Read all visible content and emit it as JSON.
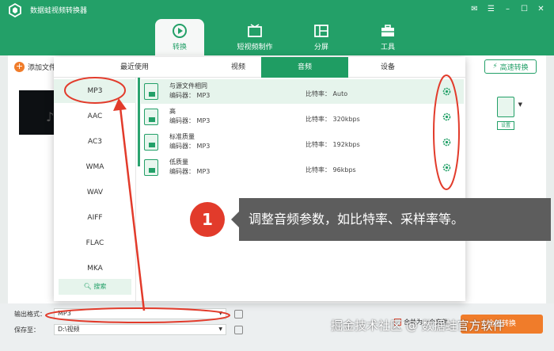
{
  "app": {
    "title": "数据蛙视频转换器"
  },
  "nav": {
    "tabs": [
      {
        "label": "转换",
        "icon": "convert-icon"
      },
      {
        "label": "短视频制作",
        "icon": "video-maker-icon"
      },
      {
        "label": "分屏",
        "icon": "split-screen-icon"
      },
      {
        "label": "工具",
        "icon": "toolbox-icon"
      }
    ],
    "active": "转换"
  },
  "toolbar": {
    "add_file": "添加文件",
    "high_speed": "高速转换"
  },
  "side": {
    "settings": "设置",
    "file_badge": "MP3"
  },
  "dialog": {
    "tabs": [
      "最近使用",
      "视频",
      "音频",
      "设备"
    ],
    "active_tab": "音频",
    "formats": [
      "MP3",
      "AAC",
      "AC3",
      "WMA",
      "WAV",
      "AIFF",
      "FLAC",
      "MKA"
    ],
    "active_format": "MP3",
    "search": "搜索",
    "encoder_label": "编码器：",
    "bitrate_label": "比特率：",
    "qualities": [
      {
        "name": "与源文件相同",
        "encoder": "MP3",
        "bitrate": "Auto"
      },
      {
        "name": "高",
        "encoder": "MP3",
        "bitrate": "320kbps"
      },
      {
        "name": "标准质量",
        "encoder": "MP3",
        "bitrate": "192kbps"
      },
      {
        "name": "低质量",
        "encoder": "MP3",
        "bitrate": "96kbps"
      }
    ]
  },
  "callout": {
    "number": "1",
    "text": "调整音频参数，如比特率、采样率等。"
  },
  "bottom": {
    "output_format_label": "输出格式：",
    "output_format_value": "MP3",
    "save_to_label": "保存至：",
    "save_to_value": "D:\\视频",
    "merge_label": "合并为一个文件",
    "convert_all": "全部转换"
  },
  "watermark": "掘金技术社区 @ 数据蛙官方软件",
  "colors": {
    "brand_green": "#23a068",
    "accent_orange": "#f07c2a",
    "annotation_red": "#e23b2b"
  }
}
